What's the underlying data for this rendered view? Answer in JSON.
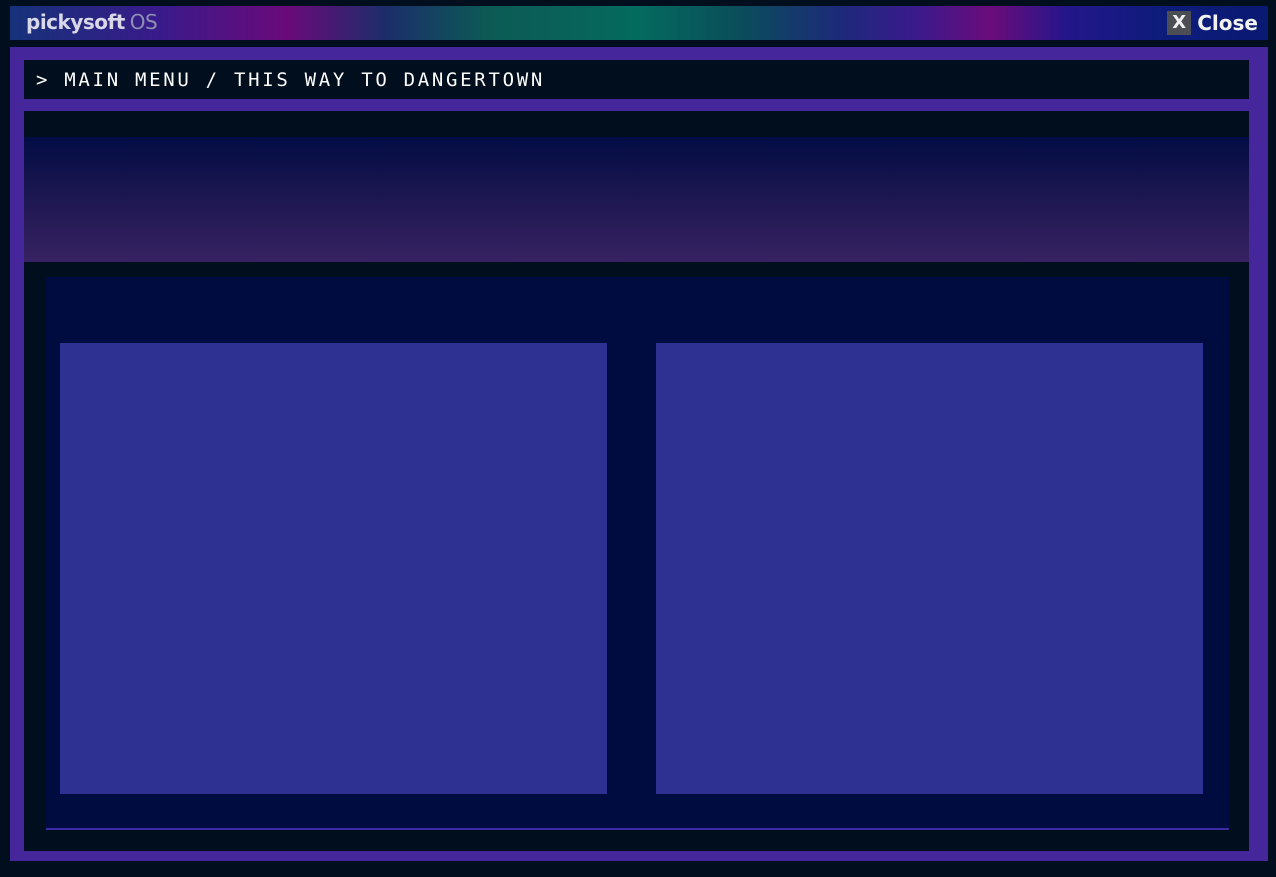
{
  "os": {
    "brand": "pickysoft",
    "brand_suffix": "OS",
    "close_icon": "X",
    "close_label": "Close"
  },
  "window": {
    "breadcrumb": "> MAIN MENU / THIS WAY TO DANGERTOWN"
  },
  "colors": {
    "frame": "#46279b",
    "background": "#000e1e",
    "inner_panel": "#000c40",
    "card": "#2e3092"
  }
}
